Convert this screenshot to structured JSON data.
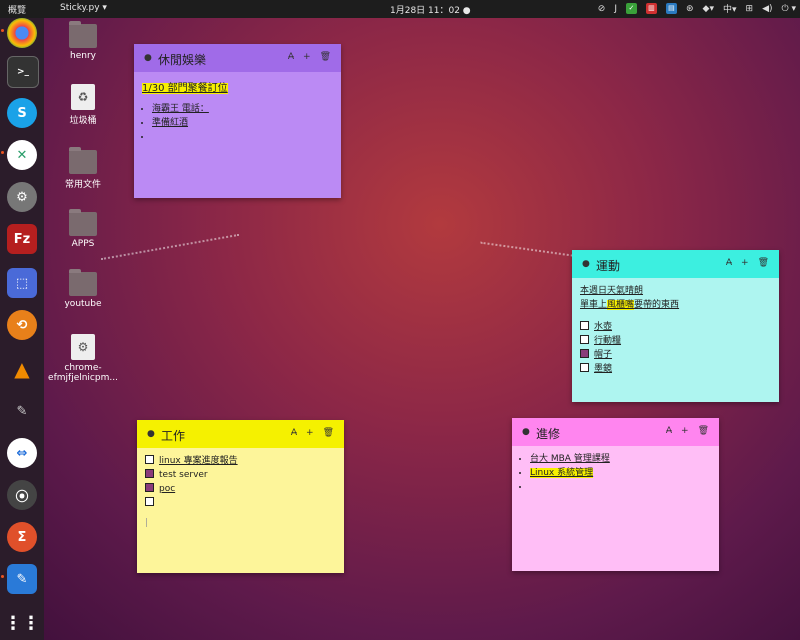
{
  "topbar": {
    "activities": "概覽",
    "app_menu": "Sticky.py ▾",
    "clock": "1月28日  11：02  ●",
    "tray_ime": "中▾",
    "tray_power": "⏻ ▾"
  },
  "desktop_icons": [
    {
      "label": "henry"
    },
    {
      "label": "垃圾桶"
    },
    {
      "label": "常用文件"
    },
    {
      "label": "APPS"
    },
    {
      "label": "youtube"
    },
    {
      "label": "chrome-efmjfjelnicpm..."
    }
  ],
  "notes": {
    "leisure": {
      "title": "休閒娛樂",
      "color": "#bb8af4",
      "header_color": "#a06be8",
      "heading": "1/30 部門聚餐訂位",
      "items": [
        "海霸王 電話：",
        "準備紅酒",
        ""
      ]
    },
    "sport": {
      "title": "運動",
      "color": "#aef5f0",
      "header_color": "#3cefe0",
      "line1": "本週日天氣晴朗",
      "line2": "單車上風櫃嘴要帶的東西",
      "line2_highlight": "風櫃嘴",
      "checks": [
        {
          "label": "水壺",
          "checked": false
        },
        {
          "label": "行動糧",
          "checked": false
        },
        {
          "label": "帽子",
          "checked": true
        },
        {
          "label": "墨鏡",
          "checked": false
        }
      ]
    },
    "work": {
      "title": "工作",
      "color": "#fdf59a",
      "header_color": "#f5f100",
      "checks": [
        {
          "label": "linux 專案進度報告",
          "checked": false
        },
        {
          "label": "test server",
          "checked": true
        },
        {
          "label": "poc",
          "checked": true
        },
        {
          "label": "",
          "checked": false
        }
      ]
    },
    "study": {
      "title": "進修",
      "color": "#ffbef6",
      "header_color": "#ff85ef",
      "items": [
        "台大 MBA 管理課程",
        "Linux 系統管理",
        ""
      ]
    }
  },
  "note_tools": {
    "font": "A̶",
    "add": "+",
    "delete": "🗑"
  }
}
